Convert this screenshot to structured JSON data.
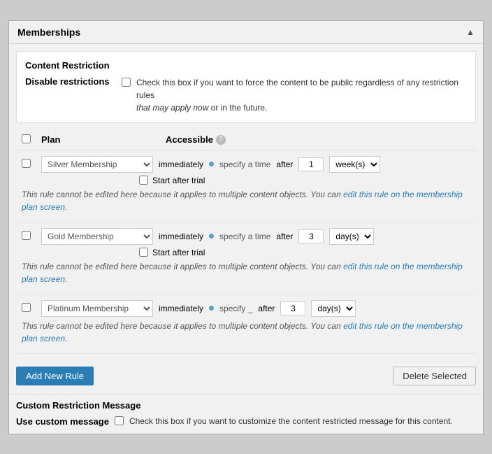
{
  "panel": {
    "title": "Memberships",
    "collapse_icon": "▲"
  },
  "content_restriction": {
    "section_title": "Content Restriction",
    "disable_label": "Disable restrictions",
    "disable_desc_1": "Check this box if you want to force the content to be public regardless of any restriction rules",
    "disable_desc_2": "that may apply now",
    "disable_desc_3": " or in the future."
  },
  "table": {
    "col_plan": "Plan",
    "col_accessible": "Accessible",
    "info_icon": "?"
  },
  "memberships": [
    {
      "name": "Silver Membership",
      "immediately": "immediately",
      "specify": "specify a time",
      "after": "after",
      "value": "1",
      "period": "week(s)",
      "show_trial": true,
      "trial_label": "Start after trial",
      "notice": "This rule cannot be edited here because it applies to multiple content objects. You can",
      "notice_link": "edit this rule on the\nmembership plan screen.",
      "notice_link_text": "edit this rule on the membership plan screen."
    },
    {
      "name": "Gold Membership",
      "immediately": "immediately",
      "specify": "specify a time",
      "after": "after",
      "value": "3",
      "period": "day(s)",
      "show_trial": true,
      "trial_label": "Start after trial",
      "notice": "This rule cannot be edited here because it applies to multiple content objects. You can",
      "notice_link_text": "edit this rule on the membership plan screen."
    },
    {
      "name": "Platinum Membership",
      "immediately": "immediately",
      "specify": "specify _",
      "after": "after",
      "value": "3",
      "period": "day(s)",
      "show_trial": false,
      "notice": "This rule cannot be edited here because it applies to multiple content objects. You can",
      "notice_link_text": "edit this rule on the membership plan screen."
    }
  ],
  "buttons": {
    "add_new": "Add New Rule",
    "delete_selected": "Delete Selected"
  },
  "custom_restriction": {
    "section_title": "Custom Restriction Message",
    "use_custom_label": "Use custom message",
    "use_custom_desc": "Check this box if you want to customize the content restricted message for this content."
  }
}
